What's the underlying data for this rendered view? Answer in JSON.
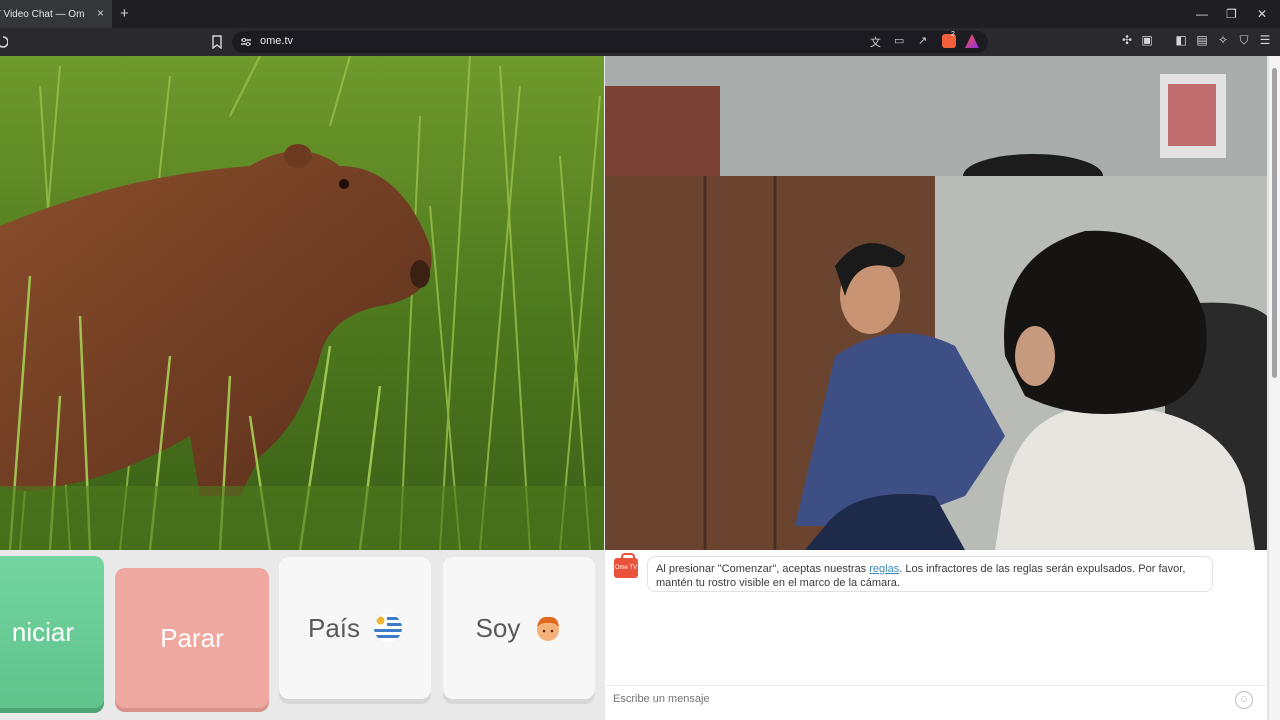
{
  "browser": {
    "tab_title": "V Video Chat — Omegl",
    "tab_close": "×",
    "new_tab": "+",
    "url": "ome.tv",
    "window_controls": [
      "—",
      "❐",
      "✕"
    ],
    "shield_count": "2"
  },
  "buttons": {
    "start_label": "niciar",
    "stop_label": "Parar",
    "country_label": "País",
    "gender_label": "Soy"
  },
  "chat": {
    "logo_text": "Ome TV",
    "notice_before_link": "Al presionar \"Comenzar\", aceptas nuestras ",
    "notice_link": "reglas",
    "notice_after_link": ". Los infractores de las reglas serán expulsados. Por favor, mantén tu rostro visible en el marco de la cámara.",
    "message_placeholder": "Escribe un mensaje"
  },
  "colors": {
    "start_button": "#5fc38c",
    "stop_button": "#eea89f",
    "link": "#3b8bb8",
    "logo": "#e9523b"
  }
}
